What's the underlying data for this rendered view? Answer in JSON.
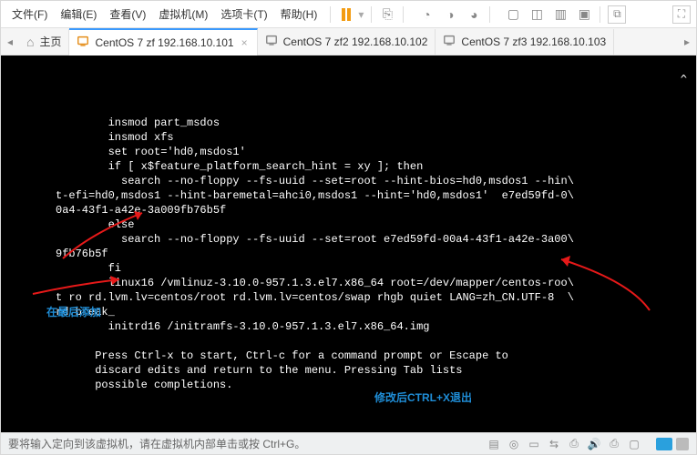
{
  "menu": {
    "items": [
      "文件(F)",
      "编辑(E)",
      "查看(V)",
      "虚拟机(M)",
      "选项卡(T)",
      "帮助(H)"
    ]
  },
  "toolbar": {
    "pause": "pause"
  },
  "tabs": {
    "home": "主页",
    "items": [
      {
        "label": "CentOS 7 zf 192.168.10.101",
        "active": true
      },
      {
        "label": "CentOS 7 zf2 192.168.10.102",
        "active": false
      },
      {
        "label": "CentOS 7 zf3 192.168.10.103",
        "active": false
      }
    ]
  },
  "console": {
    "lines": [
      "",
      "        insmod part_msdos",
      "        insmod xfs",
      "        set root='hd0,msdos1'",
      "        if [ x$feature_platform_search_hint = xy ]; then",
      "          search --no-floppy --fs-uuid --set=root --hint-bios=hd0,msdos1 --hin\\",
      "t-efi=hd0,msdos1 --hint-baremetal=ahci0,msdos1 --hint='hd0,msdos1'  e7ed59fd-0\\",
      "0a4-43f1-a42e-3a009fb76b5f",
      "        else",
      "          search --no-floppy --fs-uuid --set=root e7ed59fd-00a4-43f1-a42e-3a00\\",
      "9fb76b5f",
      "        fi",
      "        linux16 /vmlinuz-3.10.0-957.1.3.el7.x86_64 root=/dev/mapper/centos-roo\\",
      "t ro rd.lvm.lv=centos/root rd.lvm.lv=centos/swap rhgb quiet LANG=zh_CN.UTF-8  \\",
      "rd.break_",
      "        initrd16 /initramfs-3.10.0-957.1.3.el7.x86_64.img",
      "",
      "      Press Ctrl-x to start, Ctrl-c for a command prompt or Escape to",
      "      discard edits and return to the menu. Pressing Tab lists",
      "      possible completions."
    ],
    "annotation_left": "在最后添加",
    "annotation_bottom": "修改后CTRL+X退出"
  },
  "status": {
    "text": "要将输入定向到该虚拟机，请在虚拟机内部单击或按 Ctrl+G。"
  }
}
